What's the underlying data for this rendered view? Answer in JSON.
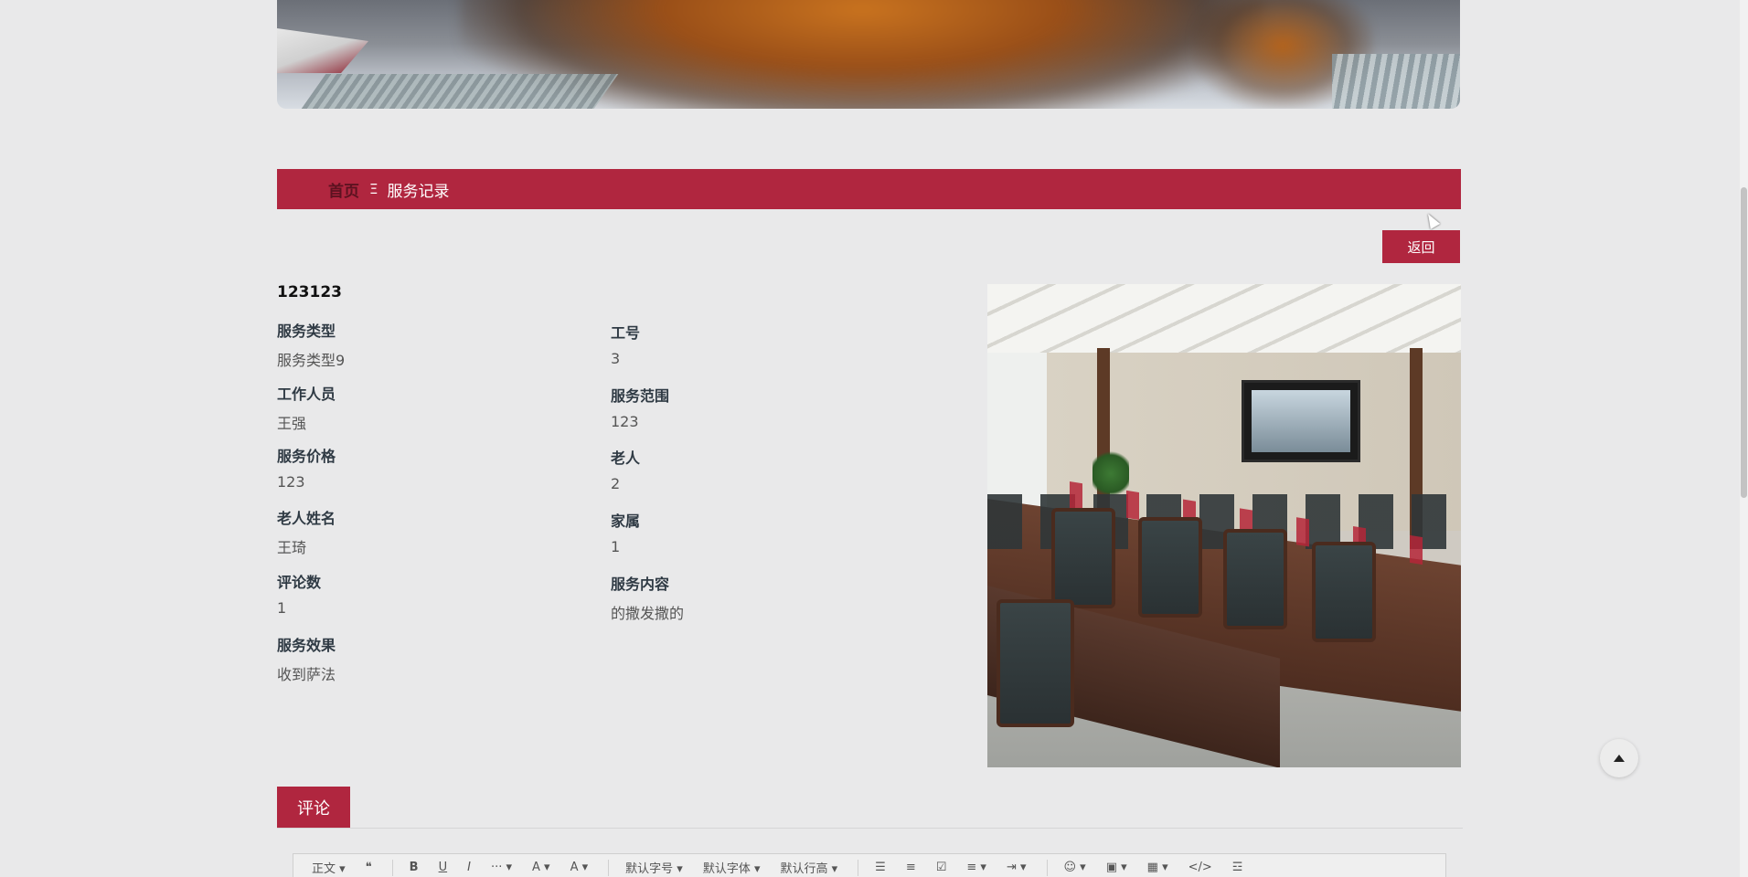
{
  "breadcrumb": {
    "home": "首页",
    "separator": "Ξ",
    "current": "服务记录"
  },
  "back_label": "返回",
  "record": {
    "title": "123123",
    "fields_left": [
      {
        "label": "服务类型",
        "value": "服务类型9"
      },
      {
        "label": "工作人员",
        "value": "王强"
      },
      {
        "label": "服务价格",
        "value": "123"
      },
      {
        "label": "老人姓名",
        "value": "王琦"
      },
      {
        "label": "评论数",
        "value": "1"
      },
      {
        "label": "服务效果",
        "value": "收到萨法"
      }
    ],
    "fields_right": [
      {
        "label": "工号",
        "value": "3"
      },
      {
        "label": "服务范围",
        "value": "123"
      },
      {
        "label": "老人",
        "value": "2"
      },
      {
        "label": "家属",
        "value": "1"
      },
      {
        "label": "服务内容",
        "value": "的撒发撒的"
      }
    ]
  },
  "comment_tab": "评论",
  "editor": {
    "toolbar": [
      "正文 ▾",
      "❝",
      "B",
      "U",
      "I",
      "··· ▾",
      "A ▾",
      "A ▾",
      "默认字号 ▾",
      "默认字体 ▾",
      "默认行高 ▾",
      "☰",
      "≡",
      "☑",
      "≡ ▾",
      "⇥ ▾",
      "☺ ▾",
      "▣ ▾",
      "▦ ▾",
      "</>",
      "☲"
    ]
  },
  "colors": {
    "accent": "#b0263f",
    "background": "#e9e9ea",
    "home_link": "#5c1220"
  },
  "icons": {
    "scroll_top": "arrow-up-icon",
    "breadcrumb_separator": "menu-icon"
  }
}
